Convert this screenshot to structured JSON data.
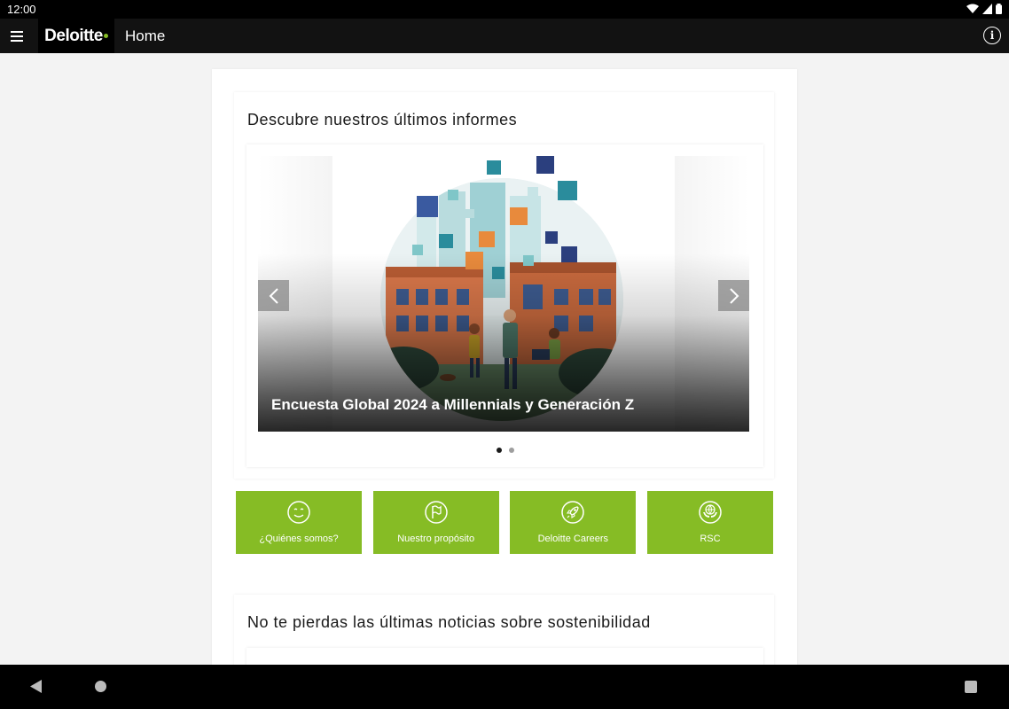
{
  "status_bar": {
    "time": "12:00"
  },
  "app_bar": {
    "logo": "Deloitte",
    "title": "Home"
  },
  "reports_section": {
    "title": "Descubre nuestros últimos informes",
    "slide_caption": "Encuesta Global 2024 a Millennials y Generación Z",
    "slide_count": 2,
    "active_slide": 1
  },
  "tiles": [
    {
      "label": "¿Quiénes somos?",
      "icon": "smile-icon"
    },
    {
      "label": "Nuestro propósito",
      "icon": "flag-icon"
    },
    {
      "label": "Deloitte Careers",
      "icon": "rocket-icon"
    },
    {
      "label": "RSC",
      "icon": "globe-hands-icon"
    }
  ],
  "news_section": {
    "title": "No te pierdas las últimas noticias sobre sostenibilidad"
  },
  "colors": {
    "brand_green": "#86bc25",
    "app_bar": "#121212",
    "background": "#f3f3f3"
  }
}
